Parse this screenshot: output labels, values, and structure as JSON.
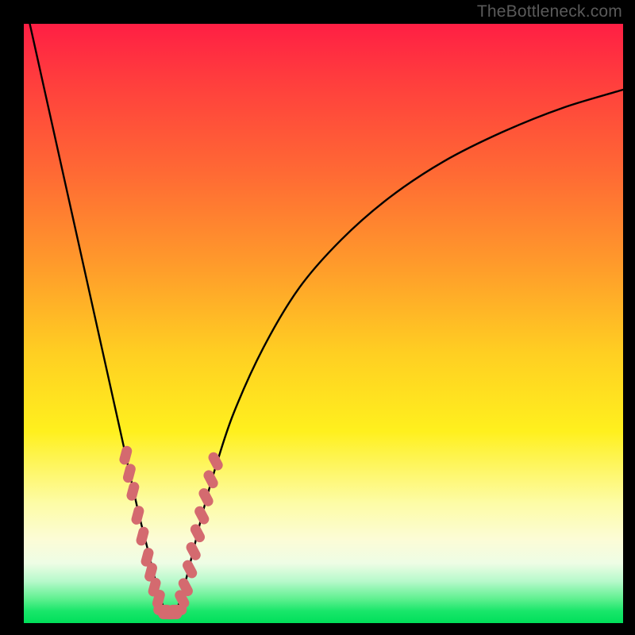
{
  "watermark": "TheBottleneck.com",
  "chart_data": {
    "type": "line",
    "title": "",
    "xlabel": "",
    "ylabel": "",
    "xlim": [
      0,
      100
    ],
    "ylim": [
      0,
      100
    ],
    "curve": {
      "name": "bottleneck-curve",
      "description": "V-shaped bottleneck curve; left branch steep from top-left to minimum near x≈24, right branch rises asymptotically toward top-right",
      "x": [
        1,
        3,
        5,
        7,
        9,
        11,
        13,
        15,
        17,
        19,
        20.5,
        22,
        23,
        24,
        25,
        26,
        27,
        28.5,
        30,
        32,
        35,
        40,
        46,
        53,
        61,
        70,
        80,
        90,
        100
      ],
      "y": [
        100,
        91,
        82,
        73,
        64,
        55,
        46,
        37,
        28,
        19,
        13,
        7,
        3.5,
        1.5,
        1.5,
        3.5,
        7,
        13,
        19,
        26,
        35,
        46,
        56,
        64,
        71,
        77,
        82,
        86,
        89
      ]
    },
    "marker_clusters": [
      {
        "name": "left-cluster",
        "color": "#d46a6f",
        "points": [
          {
            "x": 17.0,
            "y": 28
          },
          {
            "x": 17.6,
            "y": 25
          },
          {
            "x": 18.2,
            "y": 22
          },
          {
            "x": 19.0,
            "y": 18
          },
          {
            "x": 19.8,
            "y": 14.5
          },
          {
            "x": 20.6,
            "y": 11
          },
          {
            "x": 21.2,
            "y": 8.5
          },
          {
            "x": 21.8,
            "y": 6
          },
          {
            "x": 22.5,
            "y": 4
          }
        ]
      },
      {
        "name": "bottom-cluster",
        "color": "#d46a6f",
        "points": [
          {
            "x": 23.2,
            "y": 2.2
          },
          {
            "x": 24.0,
            "y": 1.5
          },
          {
            "x": 24.8,
            "y": 1.5
          },
          {
            "x": 25.6,
            "y": 2.2
          }
        ]
      },
      {
        "name": "right-cluster",
        "color": "#d46a6f",
        "points": [
          {
            "x": 26.4,
            "y": 4
          },
          {
            "x": 27.0,
            "y": 6
          },
          {
            "x": 27.7,
            "y": 9
          },
          {
            "x": 28.3,
            "y": 12
          },
          {
            "x": 29.0,
            "y": 15
          },
          {
            "x": 29.7,
            "y": 18
          },
          {
            "x": 30.4,
            "y": 21
          },
          {
            "x": 31.2,
            "y": 24
          },
          {
            "x": 32.0,
            "y": 27
          }
        ]
      }
    ],
    "gradient_bands": [
      {
        "color": "#ff1f44",
        "stop": 0
      },
      {
        "color": "#ff9a2b",
        "stop": 40
      },
      {
        "color": "#fff01e",
        "stop": 68
      },
      {
        "color": "#fcfcd6",
        "stop": 86
      },
      {
        "color": "#19e66a",
        "stop": 98
      }
    ]
  }
}
